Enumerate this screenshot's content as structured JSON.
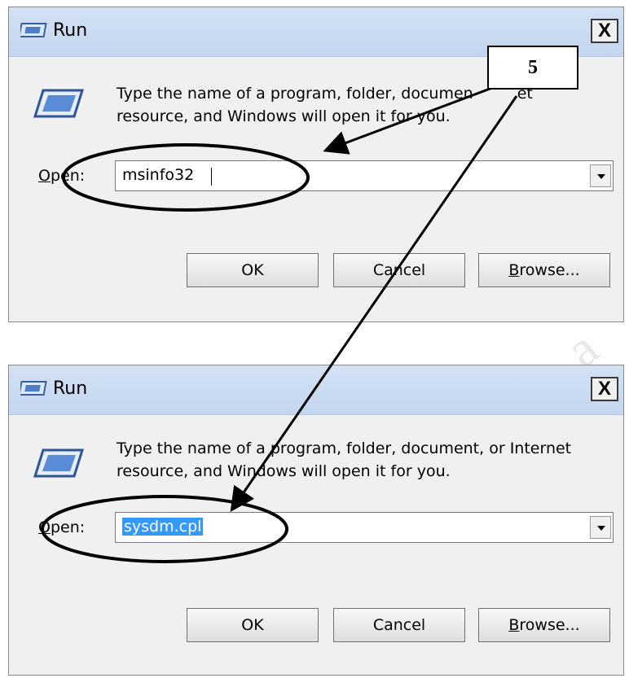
{
  "top_dialog": {
    "title": "Run",
    "close_label": "X",
    "description_line1": "Type the name of a program, folder, documen",
    "description_line1_tail": "et",
    "description_line2": "resource, and Windows will open it for you.",
    "open_label_first": "O",
    "open_label_rest": "pen:",
    "input_value": "msinfo32",
    "ok_label": "OK",
    "cancel_label": "Cancel",
    "browse_first": "B",
    "browse_rest": "rowse..."
  },
  "bottom_dialog": {
    "title": "Run",
    "close_label": "X",
    "description_line1": "Type the name of a program, folder, document, or Internet",
    "description_line2": "resource, and Windows will open it for you.",
    "open_label_first": "O",
    "open_label_rest": "pen:",
    "input_value": "sysdm.cpl",
    "ok_label": "OK",
    "cancel_label": "Cancel",
    "browse_first": "B",
    "browse_rest": "rowse..."
  },
  "callout": {
    "number": "5"
  },
  "watermark": {
    "text": "a"
  },
  "colors": {
    "titlebar": "#c9daf1",
    "dialog_bg": "#f0f0f0",
    "selection": "#3399ff"
  },
  "icons": [
    "run-icon",
    "close-icon",
    "dropdown-arrow-icon"
  ]
}
